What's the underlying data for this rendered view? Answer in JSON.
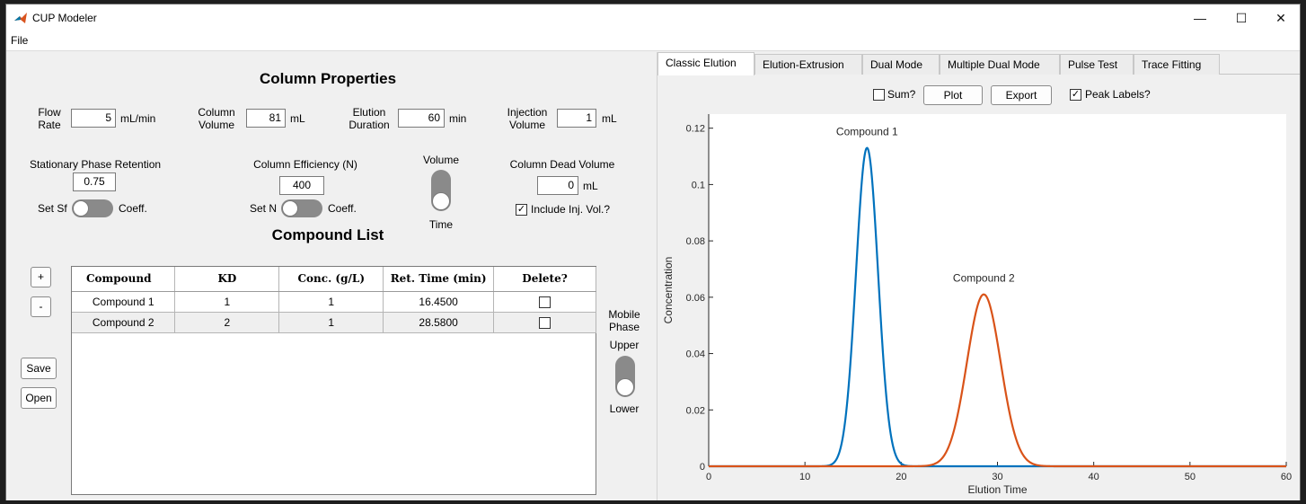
{
  "window": {
    "title": "CUP Modeler",
    "minimize": "—",
    "maximize": "☐",
    "close": "✕"
  },
  "menu": {
    "file": "File"
  },
  "column_properties": {
    "title": "Column Properties",
    "flow_rate": {
      "label_1": "Flow",
      "label_2": "Rate",
      "value": "5",
      "unit": "mL/min"
    },
    "column_volume": {
      "label_1": "Column",
      "label_2": "Volume",
      "value": "81",
      "unit": "mL"
    },
    "elution_duration": {
      "label_1": "Elution",
      "label_2": "Duration",
      "value": "60",
      "unit": "min"
    },
    "injection_volume": {
      "label_1": "Injection",
      "label_2": "Volume",
      "value": "1",
      "unit": "mL"
    },
    "stationary_phase": {
      "label": "Stationary Phase Retention",
      "value": "0.75",
      "switch_left": "Set Sf",
      "switch_right": "Coeff."
    },
    "column_efficiency": {
      "label": "Column Efficiency (N)",
      "value": "400",
      "switch_left": "Set N",
      "switch_right": "Coeff."
    },
    "volume_time_switch": {
      "top": "Volume",
      "bottom": "Time"
    },
    "dead_volume": {
      "label": "Column Dead Volume",
      "value": "0",
      "unit": "mL",
      "include_label": "Include Inj. Vol.?",
      "include_checked": true
    }
  },
  "compound_list": {
    "title": "Compound List",
    "add_label": "+",
    "remove_label": "-",
    "save_label": "Save",
    "open_label": "Open",
    "columns": [
      "Compound",
      "KD",
      "Conc. (g/L)",
      "Ret. Time (min)",
      "Delete?"
    ],
    "rows": [
      {
        "compound": "Compound 1",
        "kd": "1",
        "conc": "1",
        "ret": "16.4500",
        "delete": false
      },
      {
        "compound": "Compound 2",
        "kd": "2",
        "conc": "1",
        "ret": "28.5800",
        "delete": false
      }
    ]
  },
  "mobile_phase": {
    "label_1": "Mobile",
    "label_2": "Phase",
    "top": "Upper",
    "bottom": "Lower"
  },
  "tabs": [
    "Classic Elution",
    "Elution-Extrusion",
    "Dual Mode",
    "Multiple Dual Mode",
    "Pulse Test",
    "Trace Fitting"
  ],
  "active_tab": "Classic Elution",
  "plot_controls": {
    "sum_label": "Sum?",
    "sum_checked": false,
    "plot_label": "Plot",
    "export_label": "Export",
    "peak_labels_label": "Peak Labels?",
    "peak_labels_checked": true
  },
  "chart_data": {
    "type": "line",
    "xlabel": "Elution Time",
    "ylabel": "Concentration",
    "xlim": [
      0,
      60
    ],
    "ylim": [
      0,
      0.125
    ],
    "xticks": [
      0,
      10,
      20,
      30,
      40,
      50,
      60
    ],
    "yticks": [
      0,
      0.02,
      0.04,
      0.06,
      0.08,
      0.1,
      0.12
    ],
    "grid": false,
    "series": [
      {
        "name": "Compound 1",
        "color": "#0072bd",
        "peak_x": 16.45,
        "peak_y": 0.113,
        "sigma": 1.15
      },
      {
        "name": "Compound 2",
        "color": "#d95319",
        "peak_x": 28.58,
        "peak_y": 0.061,
        "sigma": 1.75
      }
    ]
  }
}
